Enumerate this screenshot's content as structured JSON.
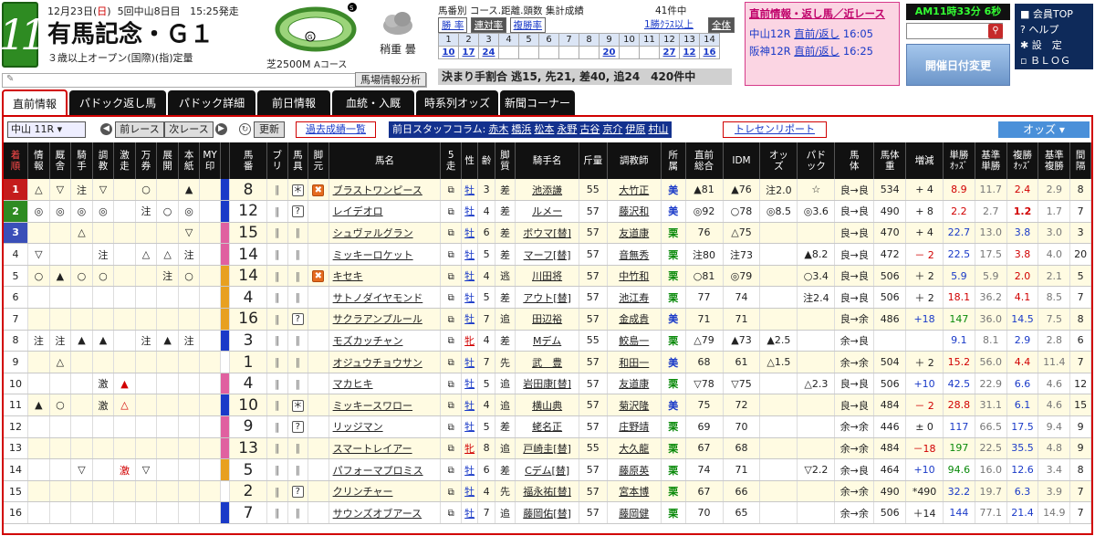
{
  "header": {
    "race_number": "11",
    "date": "12月23日",
    "weekday": "日",
    "meeting": "5回中山8日目",
    "post_time": "15:25発走",
    "title": "有馬記念・Ｇ１",
    "conditions": "３歳以上オープン(国際)(指)定量",
    "course": "芝2500M",
    "course_variant": "Aコース",
    "weather_label": "稍重 曇"
  },
  "stats": {
    "line1": "馬番別 コース.距離.頭数 集計成績",
    "tabs": [
      "勝 率",
      "連対率",
      "複勝率"
    ],
    "count": "41件中",
    "class_filter": "1勝ｸﾗｽ以上",
    "all": "全体",
    "calendar_row1": [
      "1",
      "2",
      "3",
      "4",
      "5",
      "6",
      "7",
      "8",
      "9",
      "10",
      "11",
      "12",
      "13",
      "14"
    ],
    "calendar_row2": [
      "10",
      "17",
      "24",
      "15",
      "20",
      "",
      "",
      "27",
      "12",
      "16",
      "",
      "",
      "",
      ""
    ],
    "decision": "決まり手割合 逃15, 先21, 差40, 追24　420件中"
  },
  "news": {
    "title": "直前情報・返し馬／近レース",
    "row1_race": "中山12R",
    "row1_link": "直前/返し",
    "row1_time": "16:05",
    "row2_race": "阪神12R",
    "row2_link": "直前/返し",
    "row2_time": "16:25"
  },
  "clock": "AM11時33分 6秒",
  "open_date_button": "開催日付変更",
  "menu": [
    "会員TOP",
    "ヘルプ",
    "設　定",
    "ＢＬＯＧ"
  ],
  "memo_placeholder": "",
  "baba_button": "馬場情報分析",
  "tabs": [
    "直前情報",
    "パドック返し馬",
    "パドック詳細",
    "前日情報",
    "血統・入厩",
    "時系列オッズ",
    "新聞コーナー"
  ],
  "toolbar": {
    "race_select": "中山 11R",
    "prev": "前レース",
    "next": "次レース",
    "refresh": "更新",
    "past": "過去成績一覧",
    "column_label": "前日スタッフコラム:",
    "column_names": [
      "赤木",
      "橋浜",
      "松本",
      "永野",
      "古谷",
      "京介",
      "伊原",
      "村山"
    ],
    "training": "トレセンリポート",
    "odds": "オッズ"
  },
  "columns": [
    "着順",
    "情報",
    "厩舎",
    "騎手",
    "調教",
    "激走",
    "万券",
    "展開",
    "本紙",
    "MY印",
    "",
    "馬番",
    "ブリ",
    "馬具",
    "脚元",
    "馬名",
    "5走",
    "性",
    "齢",
    "脚質",
    "騎手名",
    "斤量",
    "調教師",
    "所属",
    "直前総合",
    "IDM",
    "オッズ",
    "パドック",
    "馬体",
    "馬体重",
    "増減",
    "単勝ｵｯｽﾞ",
    "基準単勝",
    "複勝ｵｯｽﾞ",
    "基準複勝",
    "間隔"
  ],
  "rank_colors": [
    "#c41c1c",
    "#2e8b22",
    "#3a4fb8",
    "#ffffff",
    "#ffffff",
    "#ffffff",
    "#ffffff",
    "#ffffff",
    "#ffffff",
    "#ffffff",
    "#ffffff",
    "#ffffff",
    "#ffffff",
    "#ffffff",
    "#ffffff",
    "#ffffff"
  ],
  "rows": [
    {
      "rank": "1",
      "info": "△",
      "stable": "▽",
      "jockey": "注",
      "training": "▽",
      "geki": "",
      "man": "○",
      "tenkai": "",
      "honshi": "▲",
      "my": "",
      "frame": "#1a3ac8",
      "num": "8",
      "buri": "",
      "gear": "*",
      "leg": "x",
      "name": "ブラストワンピース",
      "sex": "牡",
      "age": "3",
      "style": "差",
      "jock": "池添謙",
      "kin": "55",
      "trainer": "大竹正",
      "aff": "美",
      "chokuzen": "▲81",
      "idm": "▲76",
      "oddsmark": "注2.0",
      "paddock": "☆",
      "body": "良→良",
      "weight": "534",
      "diff": "+ 4",
      "win": "8.9",
      "win_base": "11.7",
      "place": "2.4",
      "place_base": "2.9",
      "interval": "8"
    },
    {
      "rank": "2",
      "info": "◎",
      "stable": "◎",
      "jockey": "◎",
      "training": "◎",
      "geki": "",
      "man": "注",
      "tenkai": "○",
      "honshi": "◎",
      "my": "",
      "frame": "#1a3ac8",
      "num": "12",
      "buri": "",
      "gear": "?",
      "leg": "",
      "name": "レイデオロ",
      "sex": "牡",
      "age": "4",
      "style": "差",
      "jock": "ルメー",
      "kin": "57",
      "trainer": "藤沢和",
      "aff": "美",
      "chokuzen": "◎92",
      "idm": "○78",
      "oddsmark": "◎8.5",
      "paddock": "◎3.6",
      "body": "良→良",
      "weight": "490",
      "diff": "+ 8",
      "win": "2.2",
      "win_base": "2.7",
      "place": "1.2",
      "place_base": "1.7",
      "interval": "7"
    },
    {
      "rank": "3",
      "info": "",
      "stable": "",
      "jockey": "△",
      "training": "",
      "geki": "",
      "man": "",
      "tenkai": "",
      "honshi": "▽",
      "my": "",
      "frame": "#e060a0",
      "num": "15",
      "buri": "",
      "gear": "",
      "leg": "",
      "name": "シュヴァルグラン",
      "sex": "牡",
      "age": "6",
      "style": "差",
      "jock": "ボウマ[替]",
      "kin": "57",
      "trainer": "友道康",
      "aff": "栗",
      "chokuzen": "76",
      "idm": "△75",
      "oddsmark": "",
      "paddock": "",
      "body": "良→良",
      "weight": "470",
      "diff": "+ 4",
      "win": "22.7",
      "win_base": "13.0",
      "place": "3.8",
      "place_base": "3.0",
      "interval": "3"
    },
    {
      "rank": "4",
      "info": "▽",
      "stable": "",
      "jockey": "",
      "training": "注",
      "geki": "",
      "man": "△",
      "tenkai": "△",
      "honshi": "注",
      "my": "",
      "frame": "#e060a0",
      "num": "14",
      "buri": "",
      "gear": "",
      "leg": "",
      "name": "ミッキーロケット",
      "sex": "牡",
      "age": "5",
      "style": "差",
      "jock": "マーフ[替]",
      "kin": "57",
      "trainer": "音無秀",
      "aff": "栗",
      "chokuzen": "注80",
      "idm": "注73",
      "oddsmark": "",
      "paddock": "▲8.2",
      "body": "良→良",
      "weight": "472",
      "diff": "－ 2",
      "win": "22.5",
      "win_base": "17.5",
      "place": "3.8",
      "place_base": "4.0",
      "interval": "20"
    },
    {
      "rank": "5",
      "info": "○",
      "stable": "▲",
      "jockey": "○",
      "training": "○",
      "geki": "",
      "man": "",
      "tenkai": "注",
      "honshi": "○",
      "my": "",
      "frame": "#e8a020",
      "num": "14",
      "buri": "",
      "gear": "",
      "leg": "x",
      "name": "キセキ",
      "sex": "牡",
      "age": "4",
      "style": "逃",
      "jock": "川田将",
      "kin": "57",
      "trainer": "中竹和",
      "aff": "栗",
      "chokuzen": "○81",
      "idm": "◎79",
      "oddsmark": "",
      "paddock": "○3.4",
      "body": "良→良",
      "weight": "506",
      "diff": "＋ 2",
      "win": "5.9",
      "win_base": "5.9",
      "place": "2.0",
      "place_base": "2.1",
      "interval": "5"
    },
    {
      "rank": "6",
      "info": "",
      "stable": "",
      "jockey": "",
      "training": "",
      "geki": "",
      "man": "",
      "tenkai": "",
      "honshi": "",
      "my": "",
      "frame": "#e8a020",
      "num": "4",
      "buri": "",
      "gear": "",
      "leg": "",
      "name": "サトノダイヤモンド",
      "sex": "牡",
      "age": "5",
      "style": "差",
      "jock": "アウト[替]",
      "kin": "57",
      "trainer": "池江寿",
      "aff": "栗",
      "chokuzen": "77",
      "idm": "74",
      "oddsmark": "",
      "paddock": "注2.4",
      "body": "良→良",
      "weight": "506",
      "diff": "＋ 2",
      "win": "18.1",
      "win_base": "36.2",
      "place": "4.1",
      "place_base": "8.5",
      "interval": "7"
    },
    {
      "rank": "7",
      "info": "",
      "stable": "",
      "jockey": "",
      "training": "",
      "geki": "",
      "man": "",
      "tenkai": "",
      "honshi": "",
      "my": "",
      "frame": "#e8a020",
      "num": "16",
      "buri": "",
      "gear": "?",
      "leg": "",
      "name": "サクラアンプルール",
      "sex": "牡",
      "age": "7",
      "style": "追",
      "jock": "田辺裕",
      "kin": "57",
      "trainer": "金成貴",
      "aff": "美",
      "chokuzen": "71",
      "idm": "71",
      "oddsmark": "",
      "paddock": "",
      "body": "良→余",
      "weight": "486",
      "diff": "+18",
      "win": "147",
      "win_base": "36.0",
      "place": "14.5",
      "place_base": "7.5",
      "interval": "8"
    },
    {
      "rank": "8",
      "info": "注",
      "stable": "注",
      "jockey": "▲",
      "training": "▲",
      "geki": "",
      "man": "注",
      "tenkai": "▲",
      "honshi": "注",
      "my": "",
      "frame": "#1a3ac8",
      "num": "3",
      "buri": "",
      "gear": "",
      "leg": "",
      "name": "モズカッチャン",
      "sex": "牝",
      "age": "4",
      "style": "差",
      "jock": "Mデム",
      "kin": "55",
      "trainer": "鮫島一",
      "aff": "栗",
      "chokuzen": "△79",
      "idm": "▲73",
      "oddsmark": "▲2.5",
      "paddock": "",
      "body": "余→良",
      "weight": "",
      "diff": "",
      "win": "9.1",
      "win_base": "8.1",
      "place": "2.9",
      "place_base": "2.8",
      "interval": "6"
    },
    {
      "rank": "9",
      "info": "",
      "stable": "△",
      "jockey": "",
      "training": "",
      "geki": "",
      "man": "",
      "tenkai": "",
      "honshi": "",
      "my": "",
      "frame": "#fff",
      "num": "1",
      "buri": "",
      "gear": "",
      "leg": "",
      "name": "オジュウチョウサン",
      "sex": "牡",
      "age": "7",
      "style": "先",
      "jock": "武　豊",
      "kin": "57",
      "trainer": "和田一",
      "aff": "美",
      "chokuzen": "68",
      "idm": "61",
      "oddsmark": "△1.5",
      "paddock": "",
      "body": "余→余",
      "weight": "504",
      "diff": "＋ 2",
      "win": "15.2",
      "win_base": "56.0",
      "place": "4.4",
      "place_base": "11.4",
      "interval": "7"
    },
    {
      "rank": "10",
      "info": "",
      "stable": "",
      "jockey": "",
      "training": "激",
      "geki": "▲",
      "man": "",
      "tenkai": "",
      "honshi": "",
      "my": "",
      "frame": "#e060a0",
      "num": "4",
      "buri": "",
      "gear": "",
      "leg": "",
      "name": "マカヒキ",
      "sex": "牡",
      "age": "5",
      "style": "追",
      "jock": "岩田康[替]",
      "kin": "57",
      "trainer": "友道康",
      "aff": "栗",
      "chokuzen": "▽78",
      "idm": "▽75",
      "oddsmark": "",
      "paddock": "△2.3",
      "body": "良→良",
      "weight": "506",
      "diff": "+10",
      "win": "42.5",
      "win_base": "22.9",
      "place": "6.6",
      "place_base": "4.6",
      "interval": "12"
    },
    {
      "rank": "11",
      "info": "▲",
      "stable": "○",
      "jockey": "",
      "training": "激",
      "geki": "△",
      "man": "",
      "tenkai": "",
      "honshi": "",
      "my": "",
      "frame": "#1a3ac8",
      "num": "10",
      "buri": "",
      "gear": "*",
      "leg": "",
      "name": "ミッキースワロー",
      "sex": "牡",
      "age": "4",
      "style": "追",
      "jock": "横山典",
      "kin": "57",
      "trainer": "菊沢隆",
      "aff": "美",
      "chokuzen": "75",
      "idm": "72",
      "oddsmark": "",
      "paddock": "",
      "body": "良→良",
      "weight": "484",
      "diff": "－ 2",
      "win": "28.8",
      "win_base": "31.1",
      "place": "6.1",
      "place_base": "4.6",
      "interval": "15"
    },
    {
      "rank": "12",
      "info": "",
      "stable": "",
      "jockey": "",
      "training": "",
      "geki": "",
      "man": "",
      "tenkai": "",
      "honshi": "",
      "my": "",
      "frame": "#e060a0",
      "num": "9",
      "buri": "",
      "gear": "?",
      "leg": "",
      "name": "リッジマン",
      "sex": "牡",
      "age": "5",
      "style": "差",
      "jock": "蛯名正",
      "kin": "57",
      "trainer": "庄野靖",
      "aff": "栗",
      "chokuzen": "69",
      "idm": "70",
      "oddsmark": "",
      "paddock": "",
      "body": "余→余",
      "weight": "446",
      "diff": "± 0",
      "win": "117",
      "win_base": "66.5",
      "place": "17.5",
      "place_base": "9.4",
      "interval": "9"
    },
    {
      "rank": "13",
      "info": "",
      "stable": "",
      "jockey": "",
      "training": "",
      "geki": "",
      "man": "",
      "tenkai": "",
      "honshi": "",
      "my": "",
      "frame": "#e060a0",
      "num": "13",
      "buri": "",
      "gear": "",
      "leg": "",
      "name": "スマートレイアー",
      "sex": "牝",
      "age": "8",
      "style": "追",
      "jock": "戸崎圭[替]",
      "kin": "55",
      "trainer": "大久龍",
      "aff": "栗",
      "chokuzen": "67",
      "idm": "68",
      "oddsmark": "",
      "paddock": "",
      "body": "余→余",
      "weight": "484",
      "diff": "－18",
      "win": "197",
      "win_base": "22.5",
      "place": "35.5",
      "place_base": "4.8",
      "interval": "9"
    },
    {
      "rank": "14",
      "info": "",
      "stable": "",
      "jockey": "▽",
      "training": "",
      "geki": "激",
      "man": "▽",
      "tenkai": "",
      "honshi": "",
      "my": "",
      "frame": "#e8a020",
      "num": "5",
      "buri": "",
      "gear": "",
      "leg": "",
      "name": "パフォーマプロミス",
      "sex": "牡",
      "age": "6",
      "style": "差",
      "jock": "Cデム[替]",
      "kin": "57",
      "trainer": "藤原英",
      "aff": "栗",
      "chokuzen": "74",
      "idm": "71",
      "oddsmark": "",
      "paddock": "▽2.2",
      "body": "余→良",
      "weight": "464",
      "diff": "+10",
      "win": "94.6",
      "win_base": "16.0",
      "place": "12.6",
      "place_base": "3.4",
      "interval": "8"
    },
    {
      "rank": "15",
      "info": "",
      "stable": "",
      "jockey": "",
      "training": "",
      "geki": "",
      "man": "",
      "tenkai": "",
      "honshi": "",
      "my": "",
      "frame": "#fff",
      "num": "2",
      "buri": "",
      "gear": "?",
      "leg": "",
      "name": "クリンチャー",
      "sex": "牡",
      "age": "4",
      "style": "先",
      "jock": "福永祐[替]",
      "kin": "57",
      "trainer": "宮本博",
      "aff": "栗",
      "chokuzen": "67",
      "idm": "66",
      "oddsmark": "",
      "paddock": "",
      "body": "余→余",
      "weight": "490",
      "diff": "*490",
      "win": "32.2",
      "win_base": "19.7",
      "place": "6.3",
      "place_base": "3.9",
      "interval": "7"
    },
    {
      "rank": "16",
      "info": "",
      "stable": "",
      "jockey": "",
      "training": "",
      "geki": "",
      "man": "",
      "tenkai": "",
      "honshi": "",
      "my": "",
      "frame": "#1a3ac8",
      "num": "7",
      "buri": "",
      "gear": "",
      "leg": "",
      "name": "サウンズオブアース",
      "sex": "牡",
      "age": "7",
      "style": "追",
      "jock": "藤岡佑[替]",
      "kin": "57",
      "trainer": "藤岡健",
      "aff": "栗",
      "chokuzen": "70",
      "idm": "65",
      "oddsmark": "",
      "paddock": "",
      "body": "余→余",
      "weight": "506",
      "diff": "＋14",
      "win": "144",
      "win_base": "77.1",
      "place": "21.4",
      "place_base": "14.9",
      "interval": "7"
    }
  ]
}
